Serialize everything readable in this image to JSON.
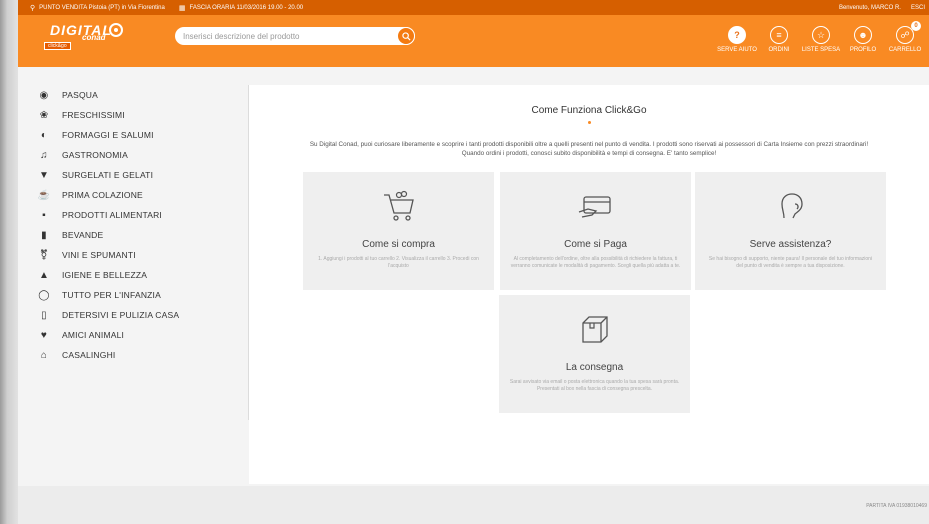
{
  "topbar": {
    "store": "PUNTO VENDITA Pistoia (PT) in Via Fiorentina",
    "slot": "FASCIA ORARIA 11/03/2016 19.00 - 20.00",
    "welcome": "Benvenuto, MARCO R.",
    "logout": "ESCI"
  },
  "header": {
    "logo_text": "DIGITAL",
    "logo_sub": "conad",
    "logo_badge": "click&go",
    "search_placeholder": "Inserisci descrizione del prodotto",
    "nav": [
      {
        "icon": "help-icon",
        "label": "SERVE AIUTO"
      },
      {
        "icon": "orders-icon",
        "label": "ORDINI"
      },
      {
        "icon": "list-icon",
        "label": "LISTE SPESA"
      },
      {
        "icon": "user-icon",
        "label": "PROFILO"
      },
      {
        "icon": "cart-icon",
        "label": "CARRELLO",
        "count": "0"
      }
    ]
  },
  "sidebar": {
    "categories": [
      {
        "label": "PASQUA",
        "icon": "easter-egg-icon"
      },
      {
        "label": "FRESCHISSIMI",
        "icon": "fresh-food-icon"
      },
      {
        "label": "FORMAGGI E SALUMI",
        "icon": "cheese-icon"
      },
      {
        "label": "GASTRONOMIA",
        "icon": "chef-hat-icon"
      },
      {
        "label": "SURGELATI E GELATI",
        "icon": "ice-cream-icon"
      },
      {
        "label": "PRIMA COLAZIONE",
        "icon": "breakfast-icon"
      },
      {
        "label": "PRODOTTI ALIMENTARI",
        "icon": "groceries-icon"
      },
      {
        "label": "BEVANDE",
        "icon": "drinks-icon"
      },
      {
        "label": "VINI E SPUMANTI",
        "icon": "wine-icon"
      },
      {
        "label": "IGIENE E BELLEZZA",
        "icon": "hygiene-icon"
      },
      {
        "label": "TUTTO PER L'INFANZIA",
        "icon": "baby-bottle-icon"
      },
      {
        "label": "DETERSIVI E PULIZIA CASA",
        "icon": "detergent-icon"
      },
      {
        "label": "AMICI ANIMALI",
        "icon": "pet-icon"
      },
      {
        "label": "CASALINGHI",
        "icon": "household-icon"
      }
    ]
  },
  "main": {
    "title": "Come Funziona Click&Go",
    "intro_line1": "Su Digital Conad, puoi curiosare liberamente e scoprire i tanti prodotti disponibili oltre a quelli presenti nel punto di vendita. I prodotti sono riservati ai possessori di Carta Insieme con prezzi straordinari!",
    "intro_line2": "Quando ordini i prodotti, conosci subito disponibilità e tempi di consegna. E' tanto semplice!",
    "cards": [
      {
        "title": "Come si compra",
        "text": "1. Aggiungi i prodotti al tuo carrello 2. Visualizza il carrello 3. Procedi con l'acquisto"
      },
      {
        "title": "Come si Paga",
        "text": "Al completamento dell'ordine, oltre alla possibilità di richiedere la fattura, ti verranno comunicate le modalità di pagamento. Scegli quella più adatta a te."
      },
      {
        "title": "Serve assistenza?",
        "text": "Se hai bisogno di supporto, niente paura! Il personale del tuo informazioni del punto di vendita è sempre a tua disposizione."
      },
      {
        "title": "La consegna",
        "text": "Sarai avvisato via email o posta elettronica quando la tua spesa sarà pronta. Presentati al box nella fascia di consegna prescelta."
      }
    ]
  },
  "footer": {
    "vat": "PARTITA IVA 01938010469"
  }
}
